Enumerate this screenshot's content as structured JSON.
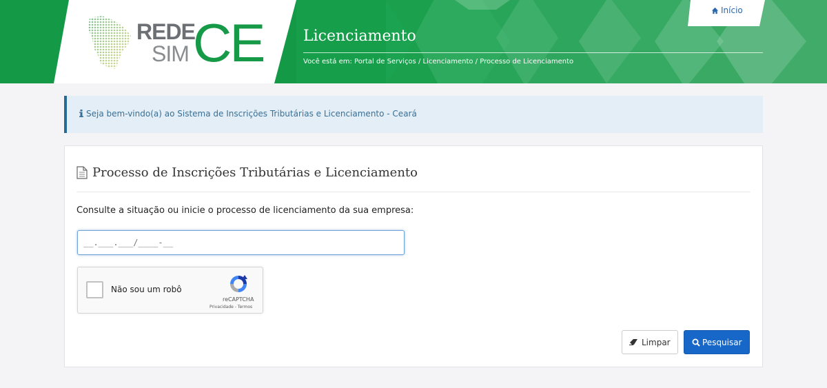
{
  "header": {
    "logo": {
      "rede": "REDE",
      "sim": "SIM",
      "ce": "CE"
    },
    "title": "Licenciamento",
    "breadcrumb": "Você está em: Portal de Serviços / Licenciamento / Processo de Licenciamento",
    "home_label": "Início"
  },
  "alert": {
    "text": "Seja bem-vindo(a) ao Sistema de Inscrições Tributárias e Licenciamento - Ceará"
  },
  "form": {
    "title": "Processo de Inscrições Tributárias e Licenciamento",
    "prompt": "Consulte a situação ou inicie o processo de licenciamento da sua empresa:",
    "cnpj_mask": "__.___.___/____-__",
    "captcha": {
      "label": "Não sou um robô",
      "brand": "reCAPTCHA",
      "terms": "Privacidade - Termos"
    },
    "clear_label": "Limpar",
    "search_label": "Pesquisar"
  },
  "colors": {
    "header_green": "#149947",
    "brand_green": "#179a47",
    "primary_blue": "#1767c8",
    "alert_bg": "#e3eef6"
  }
}
